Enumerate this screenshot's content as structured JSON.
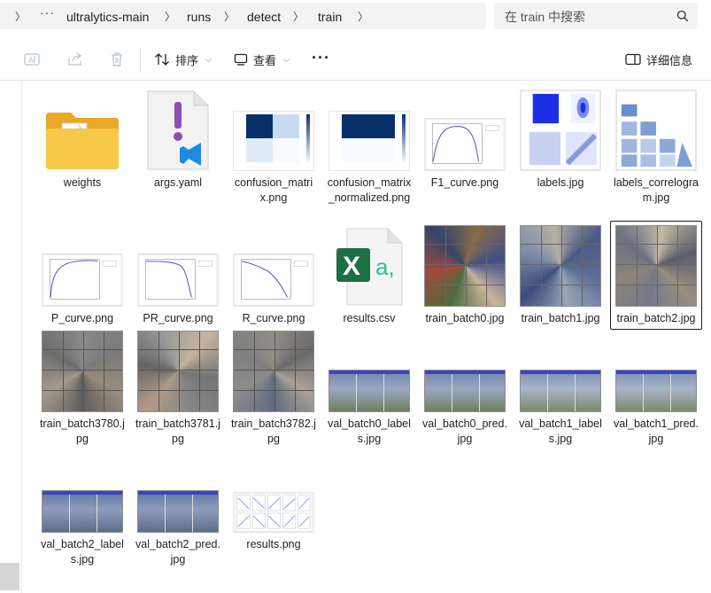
{
  "address_bar": {
    "breadcrumbs": [
      "ultralytics-main",
      "runs",
      "detect",
      "train"
    ],
    "more_label": "···"
  },
  "search": {
    "placeholder": "在 train 中搜索"
  },
  "toolbar": {
    "sort_label": "排序",
    "view_label": "查看",
    "more_label": "···",
    "details_label": "详细信息"
  },
  "files": [
    {
      "name": "weights",
      "icon": "folder-icon"
    },
    {
      "name": "args.yaml",
      "icon": "vscode-file-icon"
    },
    {
      "name": "confusion_matrix.png",
      "icon": "confusion-matrix-thumbnail"
    },
    {
      "name": "confusion_matrix_normalized.png",
      "icon": "confusion-matrix-thumbnail"
    },
    {
      "name": "F1_curve.png",
      "icon": "curve-thumbnail"
    },
    {
      "name": "labels.jpg",
      "icon": "labels-thumbnail"
    },
    {
      "name": "labels_correlogram.jpg",
      "icon": "correlogram-thumbnail"
    },
    {
      "name": "P_curve.png",
      "icon": "curve-thumbnail"
    },
    {
      "name": "PR_curve.png",
      "icon": "curve-thumbnail"
    },
    {
      "name": "R_curve.png",
      "icon": "curve-thumbnail"
    },
    {
      "name": "results.csv",
      "icon": "excel-csv-icon"
    },
    {
      "name": "train_batch0.jpg",
      "icon": "photo-mosaic-thumbnail"
    },
    {
      "name": "train_batch1.jpg",
      "icon": "photo-mosaic-thumbnail"
    },
    {
      "name": "train_batch2.jpg",
      "icon": "photo-mosaic-thumbnail",
      "selected": true
    },
    {
      "name": "train_batch3780.jpg",
      "icon": "photo-mosaic-thumbnail"
    },
    {
      "name": "train_batch3781.jpg",
      "icon": "photo-mosaic-thumbnail"
    },
    {
      "name": "train_batch3782.jpg",
      "icon": "photo-mosaic-thumbnail"
    },
    {
      "name": "val_batch0_labels.jpg",
      "icon": "val-mosaic-thumbnail"
    },
    {
      "name": "val_batch0_pred.jpg",
      "icon": "val-mosaic-thumbnail"
    },
    {
      "name": "val_batch1_labels.jpg",
      "icon": "val-mosaic-thumbnail"
    },
    {
      "name": "val_batch1_pred.jpg",
      "icon": "val-mosaic-thumbnail"
    },
    {
      "name": "val_batch2_labels.jpg",
      "icon": "val-mosaic-thumbnail"
    },
    {
      "name": "val_batch2_pred.jpg",
      "icon": "val-mosaic-thumbnail"
    },
    {
      "name": "results.png",
      "icon": "results-plot-thumbnail"
    }
  ],
  "colors": {
    "folder": "#f5c542",
    "excel": "#1d7044",
    "csv_accent": "#2fbf9c",
    "matrix_dark": "#08306b",
    "curve_line": "#5a5ad8",
    "val_banner": "#3a44c8"
  }
}
